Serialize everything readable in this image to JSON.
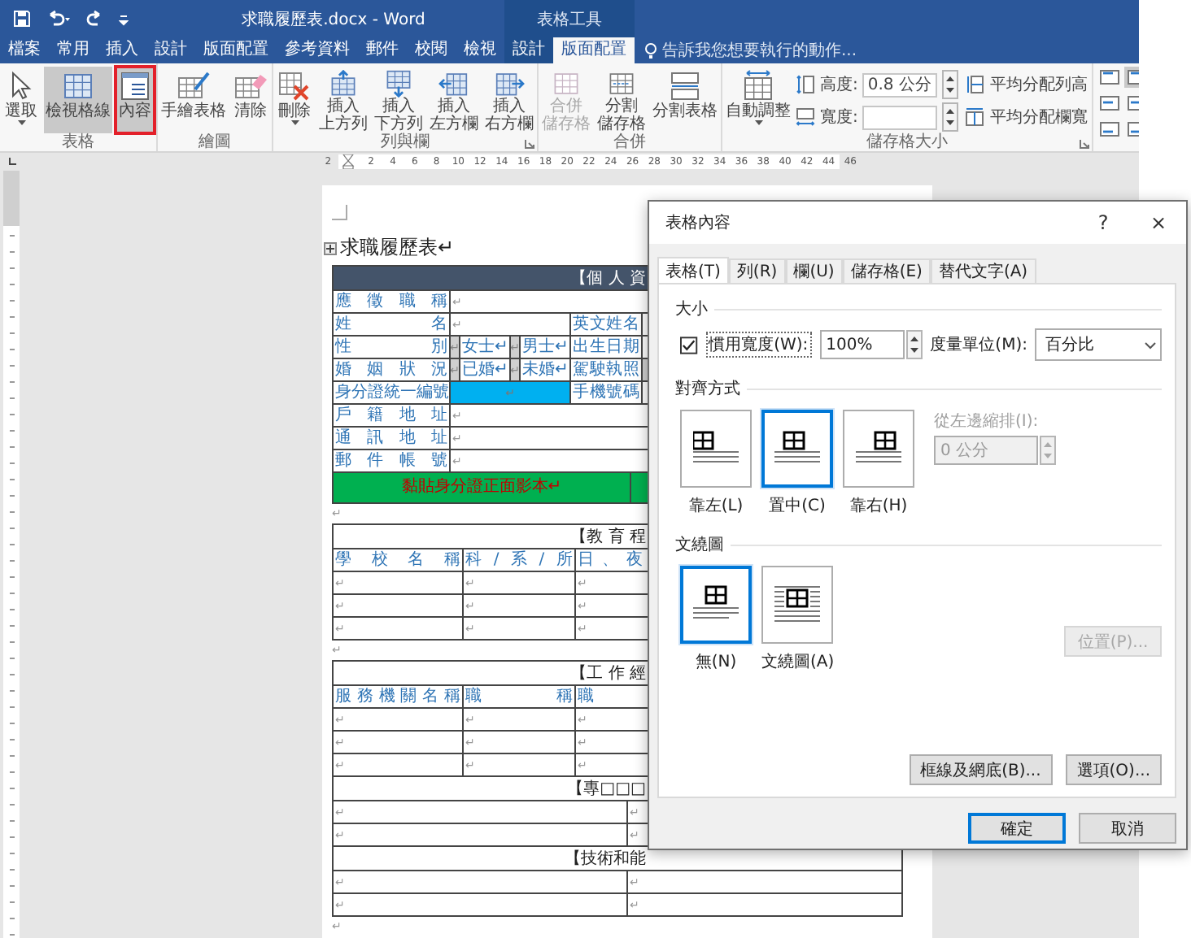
{
  "window": {
    "title": "求職履歷表.docx - Word",
    "context_title": "表格工具"
  },
  "ribbon_tabs": [
    {
      "label": "檔案",
      "selected": false,
      "kind": "main"
    },
    {
      "label": "常用",
      "selected": false,
      "kind": "main"
    },
    {
      "label": "插入",
      "selected": false,
      "kind": "main"
    },
    {
      "label": "設計",
      "selected": false,
      "kind": "main"
    },
    {
      "label": "版面配置",
      "selected": false,
      "kind": "main"
    },
    {
      "label": "參考資料",
      "selected": false,
      "kind": "main"
    },
    {
      "label": "郵件",
      "selected": false,
      "kind": "main"
    },
    {
      "label": "校閱",
      "selected": false,
      "kind": "main"
    },
    {
      "label": "檢視",
      "selected": false,
      "kind": "main"
    },
    {
      "label": "設計",
      "selected": false,
      "kind": "context"
    },
    {
      "label": "版面配置",
      "selected": true,
      "kind": "context"
    }
  ],
  "tell_me": {
    "placeholder": "告訴我您想要執行的動作..."
  },
  "ribbon_groups": [
    {
      "label": "表格",
      "controls": [
        {
          "kind": "big",
          "label": "選取",
          "dropdown": true,
          "pressed": false,
          "highlighted": false,
          "disabled": false
        },
        {
          "kind": "big",
          "label": "檢視格線",
          "dropdown": false,
          "pressed": true,
          "highlighted": false,
          "disabled": false
        },
        {
          "kind": "big",
          "label": "內容",
          "dropdown": false,
          "pressed": true,
          "highlighted": true,
          "disabled": false
        }
      ]
    },
    {
      "label": "繪圖",
      "controls": [
        {
          "kind": "big",
          "label": "手繪表格",
          "dropdown": false,
          "pressed": false,
          "highlighted": false,
          "disabled": false
        },
        {
          "kind": "big",
          "label": "清除",
          "dropdown": false,
          "pressed": false,
          "highlighted": false,
          "disabled": false
        }
      ]
    },
    {
      "label": "列與欄",
      "launcher": true,
      "controls": [
        {
          "kind": "big",
          "label": "刪除",
          "dropdown": true,
          "pressed": false,
          "highlighted": false,
          "disabled": false
        },
        {
          "kind": "big",
          "label_lines": [
            "插入",
            "上方列"
          ],
          "dropdown": false,
          "pressed": false,
          "highlighted": false,
          "disabled": false
        },
        {
          "kind": "big",
          "label_lines": [
            "插入",
            "下方列"
          ],
          "dropdown": false,
          "pressed": false,
          "highlighted": false,
          "disabled": false
        },
        {
          "kind": "big",
          "label_lines": [
            "插入",
            "左方欄"
          ],
          "dropdown": false,
          "pressed": false,
          "highlighted": false,
          "disabled": false
        },
        {
          "kind": "big",
          "label_lines": [
            "插入",
            "右方欄"
          ],
          "dropdown": false,
          "pressed": false,
          "highlighted": false,
          "disabled": false
        }
      ]
    },
    {
      "label": "合併",
      "controls": [
        {
          "kind": "big",
          "label_lines": [
            "合併",
            "儲存格"
          ],
          "dropdown": false,
          "pressed": false,
          "highlighted": false,
          "disabled": true
        },
        {
          "kind": "big",
          "label_lines": [
            "分割",
            "儲存格"
          ],
          "dropdown": false,
          "pressed": false,
          "highlighted": false,
          "disabled": false
        },
        {
          "kind": "big",
          "label": "分割表格",
          "dropdown": false,
          "pressed": false,
          "highlighted": false,
          "disabled": false
        }
      ]
    },
    {
      "label": "儲存格大小",
      "launcher": true,
      "controls": [
        {
          "kind": "big",
          "label": "自動調整",
          "dropdown": true,
          "pressed": false,
          "highlighted": false,
          "disabled": false
        },
        {
          "kind": "size-fields",
          "height_label": "高度:",
          "height_value": "0.8 公分",
          "width_label": "寬度:"
        },
        {
          "kind": "distribute",
          "rows_label": "平均分配列高",
          "columns_label": "平均分配欄寬"
        }
      ]
    }
  ],
  "alignment_buttons": [
    {
      "selected": false
    },
    {
      "selected": true
    },
    {
      "selected": false
    },
    {
      "selected": false
    },
    {
      "selected": false
    },
    {
      "selected": false
    }
  ],
  "ruler": {
    "labels": [
      "2",
      "2",
      "4",
      "6",
      "8",
      "10",
      "12",
      "14",
      "16",
      "18",
      "20",
      "22",
      "24",
      "26",
      "28",
      "30",
      "32",
      "34",
      "36",
      "38",
      "40",
      "42",
      "44",
      "46"
    ]
  },
  "document": {
    "title": "求職履歷表↵",
    "blocks": [
      {
        "kind": "table",
        "sections": [
          {
            "header": {
              "text": "【個 人 資",
              "shaded": true
            },
            "rows": [
              {
                "kind": "single",
                "cells": [
                  {
                    "kind": "label",
                    "text": "應徵職稱"
                  },
                  {
                    "kind": "mark",
                    "text": "↵"
                  }
                ]
              },
              {
                "kind": "pair",
                "cells": [
                  {
                    "kind": "label",
                    "text": "姓名"
                  },
                  {
                    "kind": "mark",
                    "text": "↵"
                  },
                  {
                    "kind": "label",
                    "text": "英文姓名"
                  },
                  {
                    "kind": "blank"
                  }
                ]
              },
              {
                "kind": "options",
                "cells": [
                  {
                    "kind": "label",
                    "text": "性別"
                  },
                  {
                    "kind": "check",
                    "text": "↵"
                  },
                  {
                    "kind": "option",
                    "text": "女士↵"
                  },
                  {
                    "kind": "check",
                    "text": "↵"
                  },
                  {
                    "kind": "option",
                    "text": "男士↵"
                  },
                  {
                    "kind": "label",
                    "text": "出生日期"
                  },
                  {
                    "kind": "blank"
                  }
                ]
              },
              {
                "kind": "options",
                "cells": [
                  {
                    "kind": "label",
                    "text": "婚姻狀況"
                  },
                  {
                    "kind": "check",
                    "text": "↵"
                  },
                  {
                    "kind": "option",
                    "text": "已婚↵"
                  },
                  {
                    "kind": "check",
                    "text": "↵"
                  },
                  {
                    "kind": "option",
                    "text": "未婚↵"
                  },
                  {
                    "kind": "label",
                    "text": "駕駛執照"
                  },
                  {
                    "kind": "check"
                  }
                ]
              },
              {
                "kind": "pair",
                "cells": [
                  {
                    "kind": "label",
                    "text": "身分證統一編號"
                  },
                  {
                    "kind": "highlight",
                    "text": "↵"
                  },
                  {
                    "kind": "label",
                    "text": "手機號碼"
                  },
                  {
                    "kind": "blank"
                  }
                ]
              },
              {
                "kind": "single",
                "cells": [
                  {
                    "kind": "label",
                    "text": "戶籍地址"
                  },
                  {
                    "kind": "mark",
                    "text": "↵"
                  }
                ]
              },
              {
                "kind": "single",
                "cells": [
                  {
                    "kind": "label",
                    "text": "通訊地址"
                  },
                  {
                    "kind": "mark",
                    "text": "↵"
                  }
                ]
              },
              {
                "kind": "single",
                "cells": [
                  {
                    "kind": "label",
                    "text": "郵件帳號"
                  },
                  {
                    "kind": "mark",
                    "text": "↵"
                  }
                ]
              },
              {
                "kind": "photo",
                "cells": [
                  {
                    "kind": "photo",
                    "text": "黏貼身分證正面影本↵"
                  },
                  {
                    "kind": "fill"
                  }
                ]
              }
            ]
          }
        ]
      },
      {
        "kind": "paragraph",
        "text": "↵"
      },
      {
        "kind": "table",
        "sections": [
          {
            "header": {
              "text": "【教 育 程",
              "shaded": false
            },
            "rows": [
              {
                "kind": "triple",
                "cells": [
                  {
                    "kind": "label",
                    "text": "學校名稱"
                  },
                  {
                    "kind": "label",
                    "text": "科/系/所"
                  },
                  {
                    "kind": "spread",
                    "text": "日、夜"
                  }
                ]
              },
              {
                "kind": "triple",
                "cells": [
                  {
                    "kind": "mark",
                    "text": "↵"
                  },
                  {
                    "kind": "mark",
                    "text": "↵"
                  },
                  {
                    "kind": "mark",
                    "text": "↵"
                  }
                ]
              },
              {
                "kind": "triple",
                "cells": [
                  {
                    "kind": "mark",
                    "text": "↵"
                  },
                  {
                    "kind": "mark",
                    "text": "↵"
                  },
                  {
                    "kind": "mark",
                    "text": "↵"
                  }
                ]
              },
              {
                "kind": "triple",
                "cells": [
                  {
                    "kind": "mark",
                    "text": "↵"
                  },
                  {
                    "kind": "mark",
                    "text": "↵"
                  },
                  {
                    "kind": "mark",
                    "text": "↵"
                  }
                ]
              }
            ]
          }
        ]
      },
      {
        "kind": "paragraph",
        "text": "↵"
      },
      {
        "kind": "table",
        "sections": [
          {
            "header": {
              "text": "【工 作 經",
              "shaded": false
            },
            "rows": [
              {
                "kind": "triple",
                "cells": [
                  {
                    "kind": "label",
                    "text": "服務機關名稱"
                  },
                  {
                    "kind": "label",
                    "text": "職稱"
                  },
                  {
                    "kind": "option",
                    "text": "職"
                  }
                ]
              },
              {
                "kind": "triple",
                "cells": [
                  {
                    "kind": "mark",
                    "text": "↵"
                  },
                  {
                    "kind": "mark",
                    "text": "↵"
                  },
                  {
                    "kind": "mark",
                    "text": "↵"
                  }
                ]
              },
              {
                "kind": "triple",
                "cells": [
                  {
                    "kind": "mark",
                    "text": "↵"
                  },
                  {
                    "kind": "mark",
                    "text": "↵"
                  },
                  {
                    "kind": "mark",
                    "text": "↵"
                  }
                ]
              },
              {
                "kind": "triple",
                "cells": [
                  {
                    "kind": "mark",
                    "text": "↵"
                  },
                  {
                    "kind": "mark",
                    "text": "↵"
                  },
                  {
                    "kind": "mark",
                    "text": "↵"
                  }
                ]
              }
            ]
          },
          {
            "header": {
              "text": "【專□□□",
              "shaded": false
            },
            "rows": [
              {
                "kind": "double",
                "cells": [
                  {
                    "kind": "mark",
                    "text": "↵"
                  },
                  {
                    "kind": "mark",
                    "text": "↵"
                  }
                ]
              },
              {
                "kind": "double",
                "cells": [
                  {
                    "kind": "mark",
                    "text": "↵"
                  },
                  {
                    "kind": "mark",
                    "text": "↵"
                  }
                ]
              }
            ]
          },
          {
            "header": {
              "text": "【技術和能",
              "shaded": false
            },
            "rows": [
              {
                "kind": "double",
                "cells": [
                  {
                    "kind": "mark",
                    "text": "↵"
                  },
                  {
                    "kind": "mark",
                    "text": "↵"
                  }
                ]
              },
              {
                "kind": "double",
                "cells": [
                  {
                    "kind": "mark",
                    "text": "↵"
                  },
                  {
                    "kind": "mark",
                    "text": "↵"
                  }
                ]
              }
            ]
          }
        ]
      },
      {
        "kind": "paragraph",
        "text": "↵"
      }
    ]
  },
  "dialog": {
    "title": "表格內容",
    "help": "?",
    "close": "×",
    "tabs": [
      {
        "label": "表格(T)",
        "selected": true
      },
      {
        "label": "列(R)",
        "selected": false
      },
      {
        "label": "欄(U)",
        "selected": false
      },
      {
        "label": "儲存格(E)",
        "selected": false
      },
      {
        "label": "替代文字(A)",
        "selected": false
      }
    ],
    "size": {
      "heading": "大小",
      "preferred_width": {
        "label": "慣用寬度(W):",
        "checked": true,
        "value": "100%"
      },
      "unit": {
        "label": "度量單位(M):",
        "value": "百分比"
      }
    },
    "alignment": {
      "heading": "對齊方式",
      "options": [
        {
          "label": "靠左(L)",
          "selected": false
        },
        {
          "label": "置中(C)",
          "selected": true
        },
        {
          "label": "靠右(H)",
          "selected": false
        }
      ],
      "indent": {
        "label": "從左邊縮排(I):",
        "value": "0 公分",
        "disabled": true
      }
    },
    "wrapping": {
      "heading": "文繞圖",
      "options": [
        {
          "label": "無(N)",
          "selected": true
        },
        {
          "label": "文繞圖(A)",
          "selected": false
        }
      ],
      "position_button": {
        "label": "位置(P)...",
        "disabled": true
      }
    },
    "buttons": [
      {
        "label": "框線及網底(B)..."
      },
      {
        "label": "選項(O)..."
      }
    ],
    "footer_buttons": [
      {
        "label": "確定",
        "default": true
      },
      {
        "label": "取消",
        "default": false
      }
    ]
  }
}
